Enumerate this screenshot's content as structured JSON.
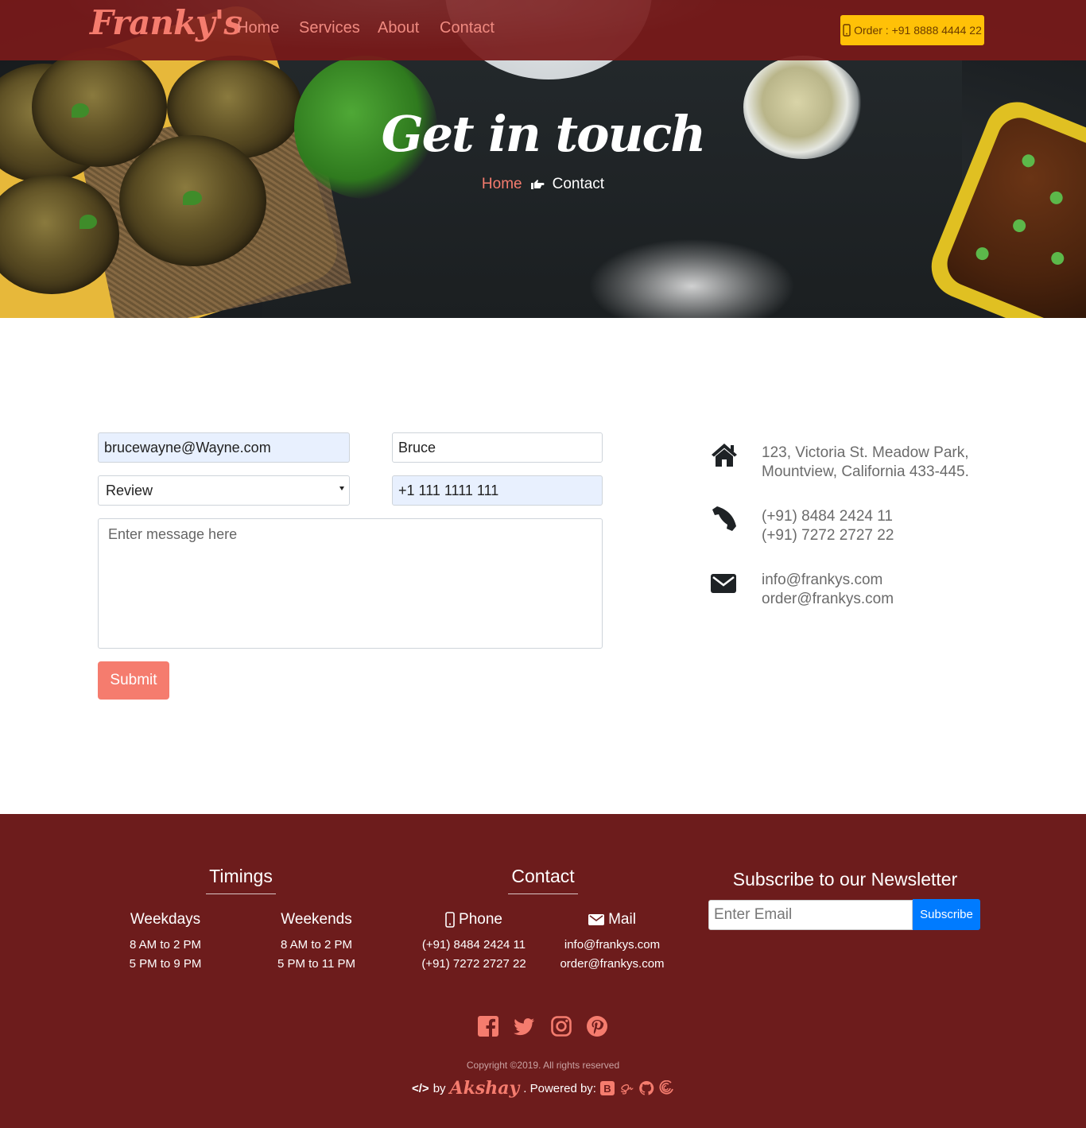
{
  "brand": {
    "name": "Franky's"
  },
  "nav": {
    "links": [
      "Home",
      "Services",
      "About",
      "Contact"
    ],
    "order_label": "Order : +91 8888 4444 22"
  },
  "hero": {
    "title": "Get in touch",
    "breadcrumb": {
      "home": "Home",
      "current": "Contact"
    }
  },
  "form": {
    "email_value": "brucewayne@Wayne.com",
    "name_value": "Bruce",
    "subject_selected": "Review",
    "phone_value": "+1 111 1111 111",
    "message_placeholder": "Enter message here",
    "submit_label": "Submit"
  },
  "contact_info": {
    "address": [
      "123, Victoria St. Meadow Park,",
      "Mountview, California 433-445."
    ],
    "phones": [
      "(+91) 8484 2424 11",
      "(+91) 7272 2727 22"
    ],
    "emails": [
      "info@frankys.com",
      "order@frankys.com"
    ],
    "icons": [
      "home-icon",
      "phone-icon",
      "envelope-icon"
    ]
  },
  "footer": {
    "timings": {
      "heading": "Timings",
      "weekdays": {
        "title": "Weekdays",
        "lines": [
          "8 AM to 2 PM",
          "5 PM to 9 PM"
        ]
      },
      "weekends": {
        "title": "Weekends",
        "lines": [
          "8 AM to 2 PM",
          "5 PM to 11 PM"
        ]
      }
    },
    "contact": {
      "heading": "Contact",
      "phone": {
        "title": "Phone",
        "lines": [
          "(+91) 8484 2424 11",
          "(+91) 7272 2727 22"
        ]
      },
      "mail": {
        "title": "Mail",
        "lines": [
          "info@frankys.com",
          "order@frankys.com"
        ]
      }
    },
    "newsletter": {
      "heading": "Subscribe to our Newsletter",
      "placeholder": "Enter Email",
      "button_label": "Subscribe"
    },
    "social_icons": [
      "facebook-icon",
      "twitter-icon",
      "instagram-icon",
      "pinterest-icon"
    ],
    "copyright": "Copyright ©2019. All rights reserved",
    "credits": {
      "code_symbol": "</>",
      "by": "by",
      "author": "Akshay",
      "powered_by": ". Powered by:"
    }
  },
  "colors": {
    "brand_coral": "#f57c6e",
    "nav_bg": "#781a1a",
    "footer_bg": "#6d1c1c",
    "order_yellow": "#ffc107",
    "subscribe_blue": "#007bff"
  }
}
